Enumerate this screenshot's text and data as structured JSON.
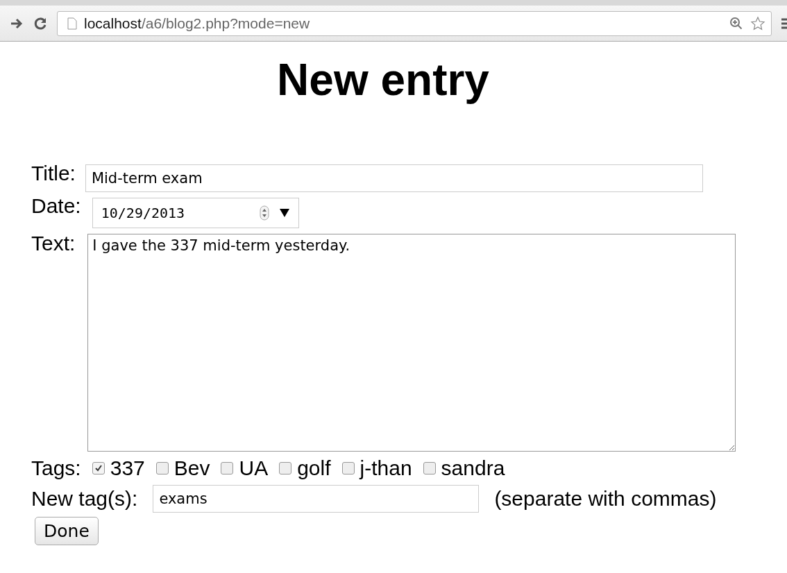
{
  "browser": {
    "url_host": "localhost",
    "url_path": "/a6/blog2.php?mode=new"
  },
  "heading": "New entry",
  "form": {
    "title_label": "Title:",
    "title_value": "Mid-term exam",
    "date_label": "Date:",
    "date_value": "10/29/2013",
    "text_label": "Text:",
    "text_value": "I gave the 337 mid-term yesterday.",
    "tags_label": "Tags:",
    "tags": [
      {
        "label": "337",
        "checked": true
      },
      {
        "label": "Bev",
        "checked": false
      },
      {
        "label": "UA",
        "checked": false
      },
      {
        "label": "golf",
        "checked": false
      },
      {
        "label": "j-than",
        "checked": false
      },
      {
        "label": "sandra",
        "checked": false
      }
    ],
    "new_tags_label": "New tag(s):",
    "new_tags_value": "exams",
    "new_tags_hint": "(separate with commas)",
    "submit": "Done"
  }
}
